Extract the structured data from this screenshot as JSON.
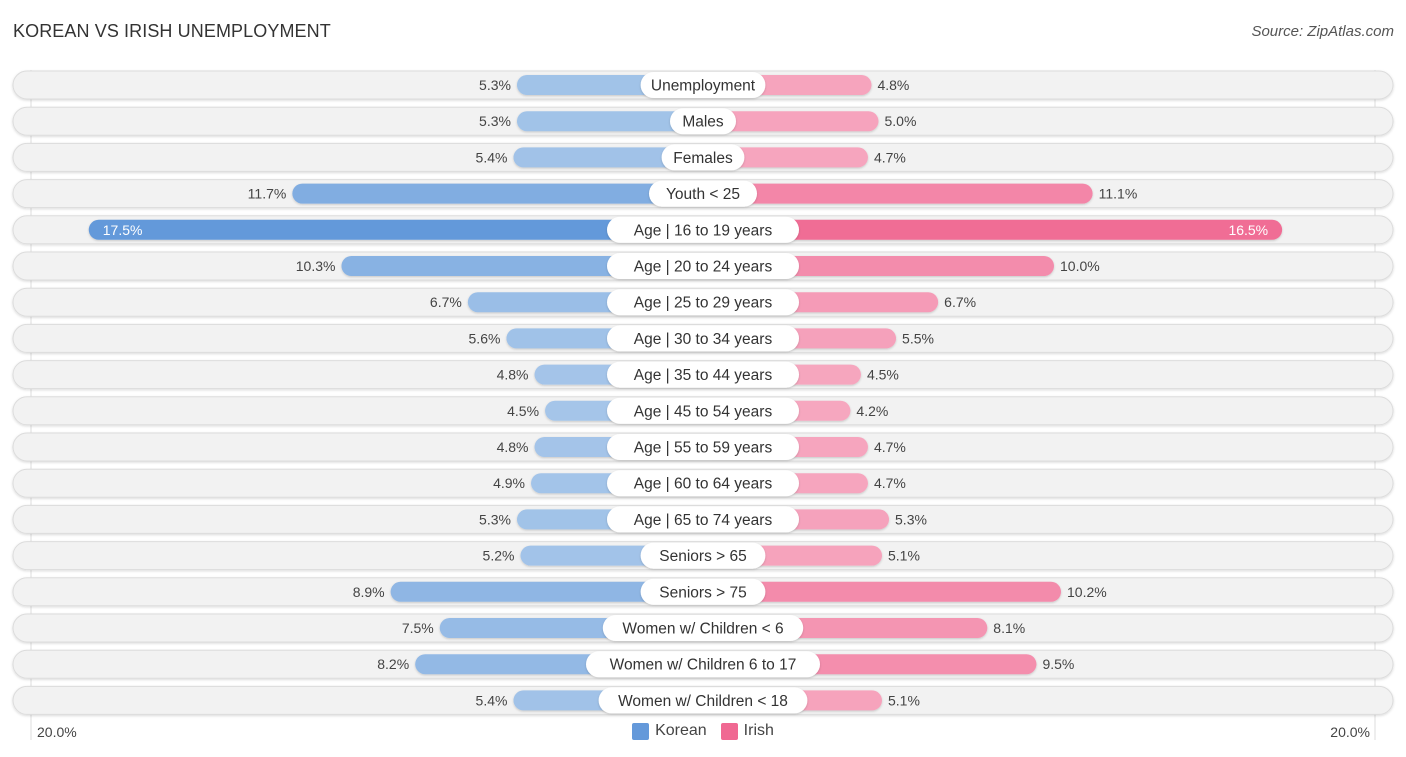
{
  "header": {
    "title": "KOREAN VS IRISH UNEMPLOYMENT",
    "source": "Source: ZipAtlas.com"
  },
  "legend": {
    "korean_label": "Korean",
    "irish_label": "Irish"
  },
  "axis": {
    "left_label": "20.0%",
    "right_label": "20.0%"
  },
  "colors": {
    "korean_light": "#a8c7ea",
    "korean_strong": "#6499da",
    "irish_light": "#f6a8c0",
    "irish_strong": "#f06892",
    "track": "#f2f2f2",
    "track_border": "#dcdcdc"
  },
  "chart_data": {
    "type": "bar",
    "orientation": "horizontal-diverging",
    "title": "KOREAN VS IRISH UNEMPLOYMENT",
    "xlabel": "",
    "ylabel": "",
    "xlim": [
      -20,
      20
    ],
    "unit": "%",
    "legend_position": "bottom-center",
    "categories": [
      "Unemployment",
      "Males",
      "Females",
      "Youth < 25",
      "Age | 16 to 19 years",
      "Age | 20 to 24 years",
      "Age | 25 to 29 years",
      "Age | 30 to 34 years",
      "Age | 35 to 44 years",
      "Age | 45 to 54 years",
      "Age | 55 to 59 years",
      "Age | 60 to 64 years",
      "Age | 65 to 74 years",
      "Seniors > 65",
      "Seniors > 75",
      "Women w/ Children < 6",
      "Women w/ Children 6 to 17",
      "Women w/ Children < 18"
    ],
    "series": [
      {
        "name": "Korean",
        "side": "left",
        "values": [
          5.3,
          5.3,
          5.4,
          11.7,
          17.5,
          10.3,
          6.7,
          5.6,
          4.8,
          4.5,
          4.8,
          4.9,
          5.3,
          5.2,
          8.9,
          7.5,
          8.2,
          5.4
        ],
        "labels": [
          "5.3%",
          "5.3%",
          "5.4%",
          "11.7%",
          "17.5%",
          "10.3%",
          "6.7%",
          "5.6%",
          "4.8%",
          "4.5%",
          "4.8%",
          "4.9%",
          "5.3%",
          "5.2%",
          "8.9%",
          "7.5%",
          "8.2%",
          "5.4%"
        ]
      },
      {
        "name": "Irish",
        "side": "right",
        "values": [
          4.8,
          5.0,
          4.7,
          11.1,
          16.5,
          10.0,
          6.7,
          5.5,
          4.5,
          4.2,
          4.7,
          4.7,
          5.3,
          5.1,
          10.2,
          8.1,
          9.5,
          5.1
        ],
        "labels": [
          "4.8%",
          "5.0%",
          "4.7%",
          "11.1%",
          "16.5%",
          "10.0%",
          "6.7%",
          "5.5%",
          "4.5%",
          "4.2%",
          "4.7%",
          "4.7%",
          "5.3%",
          "5.1%",
          "10.2%",
          "8.1%",
          "9.5%",
          "5.1%"
        ]
      }
    ],
    "tick_labels": [
      "20.0%",
      "20.0%"
    ],
    "grid": false
  }
}
